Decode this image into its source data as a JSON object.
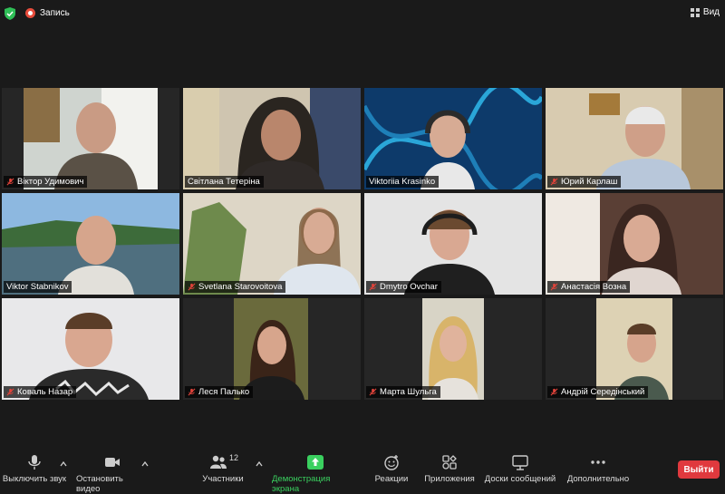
{
  "top": {
    "record_label": "Запись",
    "view_label": "Вид"
  },
  "participants": [
    {
      "name": "Віктор Удимович",
      "muted": true,
      "active": false
    },
    {
      "name": "Світлана Тетеріна",
      "muted": false,
      "active": true
    },
    {
      "name": "Viktoriia Krasinko",
      "muted": false,
      "active": false
    },
    {
      "name": "Юрий Карлаш",
      "muted": true,
      "active": false
    },
    {
      "name": "Viktor Stabnikov",
      "muted": false,
      "active": false
    },
    {
      "name": "Svetlana Starovoitova",
      "muted": true,
      "active": false
    },
    {
      "name": "Dmytro Ovchar",
      "muted": true,
      "active": false
    },
    {
      "name": "Анастасія Возна",
      "muted": true,
      "active": false
    },
    {
      "name": "Коваль Назар",
      "muted": true,
      "active": false
    },
    {
      "name": "Леся Палько",
      "muted": true,
      "active": false
    },
    {
      "name": "Марта Шульга",
      "muted": true,
      "active": false
    },
    {
      "name": "Андрій Середінський",
      "muted": true,
      "active": false
    }
  ],
  "toolbar": {
    "mute_label": "Выключить звук",
    "video_label": "Остановить видео",
    "participants_label": "Участники",
    "participants_count": "12",
    "share_label": "Демонстрация экрана",
    "reactions_label": "Реакции",
    "apps_label": "Приложения",
    "whiteboard_label": "Доски сообщений",
    "more_label": "Дополнительно",
    "leave_label": "Выйти"
  },
  "colors": {
    "share_green": "#3ad05f",
    "leave_red": "#e0393e",
    "active_speaker": "#e6e34a",
    "background": "#1a1a1a"
  }
}
